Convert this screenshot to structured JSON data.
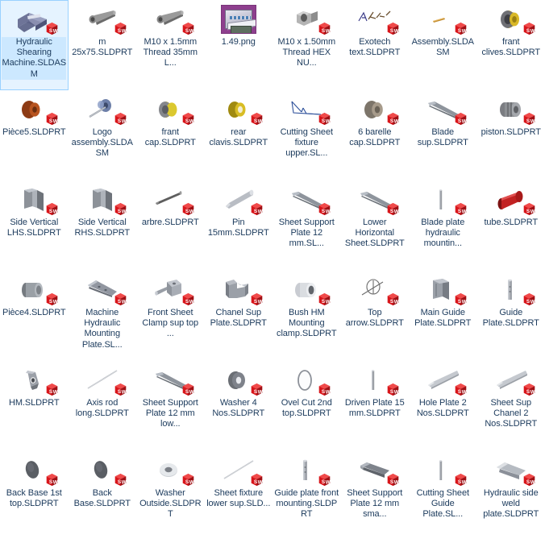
{
  "window": {
    "view": "icon-grid",
    "columns": 8,
    "rows": 7,
    "background": "#ffffff",
    "label_color": "#1b3a5c",
    "selection_fill": "#e5f3ff",
    "selection_border": "#99d1ff"
  },
  "badge": {
    "name": "solidworks-badge",
    "text_s": "S",
    "text_w": "W",
    "color_face": "#d8161b",
    "color_top": "#f04a4a",
    "color_side": "#a01015"
  },
  "files": [
    {
      "name": "Hydraulic Shearing Machine.SLDASM",
      "icon": "assembly-machine",
      "badge": "solidworks-badge",
      "selected": true
    },
    {
      "name": "m 25x75.SLDPRT",
      "icon": "bolt-grey",
      "badge": "solidworks-badge",
      "selected": false
    },
    {
      "name": "M10 x 1.5mm Thread 35mm L...",
      "icon": "bolt-grey",
      "badge": "solidworks-badge",
      "selected": false
    },
    {
      "name": "1.49.png",
      "icon": "png-image",
      "badge": "none",
      "selected": false
    },
    {
      "name": "M10 x 1.50mm Thread HEX NU...",
      "icon": "hex-nut",
      "badge": "solidworks-badge",
      "selected": false
    },
    {
      "name": "Exotech text.SLDPRT",
      "icon": "text-sketch",
      "badge": "solidworks-badge",
      "selected": false
    },
    {
      "name": "Assembly.SLDASM",
      "icon": "tiny-sliver",
      "badge": "solidworks-badge",
      "selected": false
    },
    {
      "name": "frant clives.SLDPRT",
      "icon": "ring-gold-grey",
      "badge": "solidworks-badge",
      "selected": false
    },
    {
      "name": "Pièce5.SLDPRT",
      "icon": "ring-brown",
      "badge": "solidworks-badge",
      "selected": false
    },
    {
      "name": "Logo assembly.SLDASM",
      "icon": "logo-assembly",
      "badge": "solidworks-badge",
      "selected": false
    },
    {
      "name": "frant cap.SLDPRT",
      "icon": "cap-yellow",
      "badge": "solidworks-badge",
      "selected": false
    },
    {
      "name": "rear clavis.SLDPRT",
      "icon": "ring-yellow",
      "badge": "solidworks-badge",
      "selected": false
    },
    {
      "name": "Cutting Sheet fixture upper.SL...",
      "icon": "wire-sketch",
      "badge": "solidworks-badge",
      "selected": false
    },
    {
      "name": "6 barelle cap.SLDPRT",
      "icon": "ring-tan",
      "badge": "solidworks-badge",
      "selected": false
    },
    {
      "name": "Blade sup.SLDPRT",
      "icon": "bar-diag",
      "badge": "solidworks-badge",
      "selected": false
    },
    {
      "name": "piston.SLDPRT",
      "icon": "piston-grey",
      "badge": "solidworks-badge",
      "selected": false
    },
    {
      "name": "Side Vertical LHS.SLDPRT",
      "icon": "angle-plate",
      "badge": "solidworks-badge",
      "selected": false
    },
    {
      "name": "Side Vertical RHS.SLDPRT",
      "icon": "angle-plate",
      "badge": "solidworks-badge",
      "selected": false
    },
    {
      "name": "arbre.SLDPRT",
      "icon": "shaft-dark",
      "badge": "solidworks-badge",
      "selected": false
    },
    {
      "name": "Pin 15mm.SLDPRT",
      "icon": "pin-light",
      "badge": "solidworks-badge",
      "selected": false
    },
    {
      "name": "Sheet Support Plate 12 mm.SL...",
      "icon": "bar-diag",
      "badge": "solidworks-badge",
      "selected": false
    },
    {
      "name": "Lower Horizontal Sheet.SLDPRT",
      "icon": "bar-diag",
      "badge": "solidworks-badge",
      "selected": false
    },
    {
      "name": "Blade plate hydraulic mountin...",
      "icon": "thin-rod",
      "badge": "solidworks-badge",
      "selected": false
    },
    {
      "name": "tube.SLDPRT",
      "icon": "tube-red",
      "badge": "solidworks-badge",
      "selected": false
    },
    {
      "name": "Pièce4.SLDPRT",
      "icon": "cylinder-grey",
      "badge": "solidworks-badge",
      "selected": false
    },
    {
      "name": "Machine Hydraulic Mounting Plate.SL...",
      "icon": "long-plate",
      "badge": "solidworks-badge",
      "selected": false
    },
    {
      "name": "Front Sheet Clamp sup top ...",
      "icon": "clamp-block",
      "badge": "solidworks-badge",
      "selected": false
    },
    {
      "name": "Chanel Sup Plate.SLDPRT",
      "icon": "channel-bracket",
      "badge": "solidworks-badge",
      "selected": false
    },
    {
      "name": "Bush HM Mounting clamp.SLDPRT",
      "icon": "bush-cylinder",
      "badge": "solidworks-badge",
      "selected": false
    },
    {
      "name": "Top arrow.SLDPRT",
      "icon": "arrow-sketch",
      "badge": "solidworks-badge",
      "selected": false
    },
    {
      "name": "Main Guide Plate.SLDPRT",
      "icon": "guide-block",
      "badge": "solidworks-badge",
      "selected": false
    },
    {
      "name": "Guide Plate.SLDPRT",
      "icon": "slim-post",
      "badge": "solidworks-badge",
      "selected": false
    },
    {
      "name": "HM.SLDPRT",
      "icon": "hook-part",
      "badge": "solidworks-badge",
      "selected": false
    },
    {
      "name": "Axis rod long.SLDPRT",
      "icon": "thin-line-rod",
      "badge": "solidworks-badge",
      "selected": false
    },
    {
      "name": "Sheet Support Plate 12 mm low...",
      "icon": "bar-diag",
      "badge": "solidworks-badge",
      "selected": false
    },
    {
      "name": "Washer 4 Nos.SLDPRT",
      "icon": "washer-dark",
      "badge": "solidworks-badge",
      "selected": false
    },
    {
      "name": "Ovel Cut 2nd top.SLDPRT",
      "icon": "oval-ring",
      "badge": "solidworks-badge",
      "selected": false
    },
    {
      "name": "Driven Plate 15 mm.SLDPRT",
      "icon": "thin-rod",
      "badge": "solidworks-badge",
      "selected": false
    },
    {
      "name": "Hole Plate 2 Nos.SLDPRT",
      "icon": "light-bar",
      "badge": "solidworks-badge",
      "selected": false
    },
    {
      "name": "Sheet Sup Chanel 2 Nos.SLDPRT",
      "icon": "light-bar",
      "badge": "solidworks-badge",
      "selected": false
    },
    {
      "name": "Back Base 1st top.SLDPRT",
      "icon": "dark-ellipse",
      "badge": "solidworks-badge",
      "selected": false
    },
    {
      "name": "Back Base.SLDPRT",
      "icon": "dark-ellipse",
      "badge": "solidworks-badge",
      "selected": false
    },
    {
      "name": "Washer Outside.SLDPRT",
      "icon": "washer-light",
      "badge": "solidworks-badge",
      "selected": false
    },
    {
      "name": "Sheet fixture lower sup.SLD...",
      "icon": "thin-line-rod",
      "badge": "solidworks-badge",
      "selected": false
    },
    {
      "name": "Guide plate front mounting.SLDPRT",
      "icon": "slim-post",
      "badge": "solidworks-badge",
      "selected": false
    },
    {
      "name": "Sheet Support Plate 12 mm sma...",
      "icon": "beam-dark",
      "badge": "solidworks-badge",
      "selected": false
    },
    {
      "name": "Cutting Sheet Guide Plate.SL...",
      "icon": "thin-rod",
      "badge": "solidworks-badge",
      "selected": false
    },
    {
      "name": "Hydraulic side weld plate.SLDPRT",
      "icon": "beam-light",
      "badge": "solidworks-badge",
      "selected": false
    }
  ]
}
